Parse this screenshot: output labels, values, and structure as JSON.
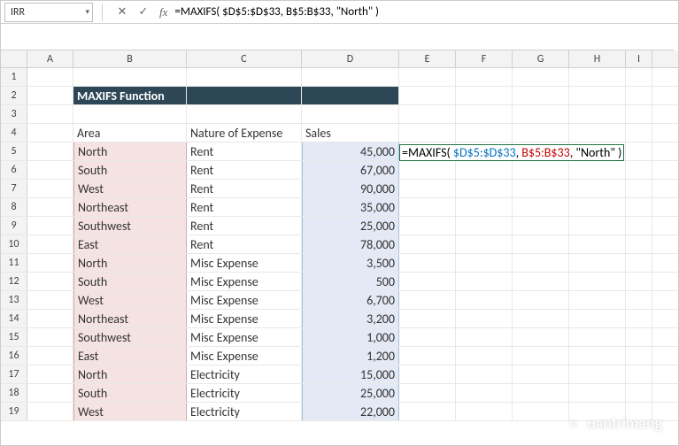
{
  "nameBox": "IRR",
  "formulaBar": "=MAXIFS( $D$5:$D$33, B$5:B$33, \"North\" )",
  "columns": [
    "A",
    "B",
    "C",
    "D",
    "E",
    "F",
    "G",
    "H",
    "I"
  ],
  "title": "MAXIFS Function",
  "headers": {
    "area": "Area",
    "nature": "Nature of Expense",
    "sales": "Sales"
  },
  "rows": [
    {
      "n": 1
    },
    {
      "n": 2,
      "title": true
    },
    {
      "n": 3
    },
    {
      "n": 4,
      "hdr": true
    },
    {
      "n": 5,
      "area": "North",
      "nat": "Rent",
      "sales": "45,000"
    },
    {
      "n": 6,
      "area": "South",
      "nat": "Rent",
      "sales": "67,000"
    },
    {
      "n": 7,
      "area": "West",
      "nat": "Rent",
      "sales": "90,000"
    },
    {
      "n": 8,
      "area": "Northeast",
      "nat": "Rent",
      "sales": "35,000"
    },
    {
      "n": 9,
      "area": "Southwest",
      "nat": "Rent",
      "sales": "25,000"
    },
    {
      "n": 10,
      "area": "East",
      "nat": "Rent",
      "sales": "78,000"
    },
    {
      "n": 11,
      "area": "North",
      "nat": "Misc Expense",
      "sales": "3,500"
    },
    {
      "n": 12,
      "area": "South",
      "nat": "Misc Expense",
      "sales": "500"
    },
    {
      "n": 13,
      "area": "West",
      "nat": "Misc Expense",
      "sales": "6,700"
    },
    {
      "n": 14,
      "area": "Northeast",
      "nat": "Misc Expense",
      "sales": "3,200"
    },
    {
      "n": 15,
      "area": "Southwest",
      "nat": "Misc Expense",
      "sales": "1,000"
    },
    {
      "n": 16,
      "area": "East",
      "nat": "Misc Expense",
      "sales": "1,200"
    },
    {
      "n": 17,
      "area": "North",
      "nat": "Electricity",
      "sales": "15,000"
    },
    {
      "n": 18,
      "area": "South",
      "nat": "Electricity",
      "sales": "25,000"
    },
    {
      "n": 19,
      "area": "West",
      "nat": "Electricity",
      "sales": "22,000"
    }
  ],
  "formulaOverlay": {
    "prefix": "=MAXIFS( ",
    "arg1": "$D$5:$D$33",
    "sep1": ", ",
    "arg2": "B$5:B$33",
    "sep2": ", ",
    "arg3": "\"North\"",
    "suffix": " )"
  },
  "watermark": "uantrimang",
  "watermarkIcon": "Q",
  "icons": {
    "cancel": "✕",
    "accept": "✓",
    "dropdown": "▾"
  }
}
